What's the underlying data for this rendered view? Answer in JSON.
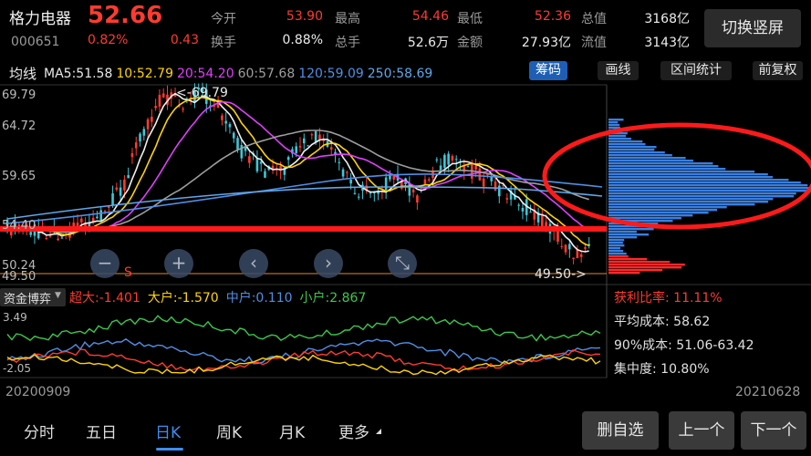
{
  "header": {
    "stock_name": "格力电器",
    "stock_code": "000651",
    "price": "52.66",
    "change_pct": "0.82%",
    "change_amt": "0.43",
    "stats": [
      {
        "label": "今开",
        "value": "53.90",
        "color": "#ff3b30"
      },
      {
        "label": "最高",
        "value": "54.46",
        "color": "#ff3b30"
      },
      {
        "label": "最低",
        "value": "52.36",
        "color": "#ff3b30"
      },
      {
        "label": "总值",
        "value": "3168亿",
        "color": "#ececec"
      },
      {
        "label": "换手",
        "value": "0.88%",
        "color": "#ececec"
      },
      {
        "label": "总手",
        "value": "52.6万",
        "color": "#ececec"
      },
      {
        "label": "金额",
        "value": "27.93亿",
        "color": "#ececec"
      },
      {
        "label": "流值",
        "value": "3143亿",
        "color": "#ececec"
      }
    ],
    "switch_button": "切换竖屏"
  },
  "ma_bar": {
    "label": "均线",
    "items": [
      {
        "text": "MA5:51.58",
        "color": "#e8e8e8"
      },
      {
        "text": "10:52.79",
        "color": "#ffd400"
      },
      {
        "text": "20:54.20",
        "color": "#e040fb"
      },
      {
        "text": "60:57.68",
        "color": "#9e9e9e"
      },
      {
        "text": "120:59.09",
        "color": "#4f8fe6"
      },
      {
        "text": "250:58.69",
        "color": "#5fa7e8"
      }
    ],
    "buttons": [
      {
        "label": "筹码",
        "active": true
      },
      {
        "label": "画线",
        "active": false
      },
      {
        "label": "区间统计",
        "active": false
      },
      {
        "label": "前复权",
        "active": false
      }
    ]
  },
  "price_axis": [
    "69.79",
    "64.72",
    "59.65",
    "54.40",
    "50.24",
    "49.50"
  ],
  "annotations": {
    "high_label": "<-69.79",
    "low_label": "49.50->",
    "s_marker": "S"
  },
  "controls": [
    {
      "name": "zoom-out",
      "glyph": "−"
    },
    {
      "name": "zoom-in",
      "glyph": "+"
    },
    {
      "name": "pan-left",
      "glyph": "‹"
    },
    {
      "name": "pan-right",
      "glyph": "›"
    },
    {
      "name": "collapse",
      "glyph": "⤡"
    }
  ],
  "indicator": {
    "selector": "资金博弈",
    "items": [
      {
        "text": "超大:-1.401",
        "color": "#ff3b30"
      },
      {
        "text": "大户:-1.570",
        "color": "#ffd400"
      },
      {
        "text": "中户:0.110",
        "color": "#4f8fe6"
      },
      {
        "text": "小户:2.867",
        "color": "#3cc84a"
      }
    ],
    "axis_top": "3.49",
    "axis_bottom": "-2.05"
  },
  "dates": {
    "start": "20200909",
    "end": "20210628"
  },
  "chips": {
    "profit_ratio": "获利比率: 11.11%",
    "avg_cost": "平均成本: 58.62",
    "cost90": "90%成本: 51.06-63.42",
    "concentration": "集中度: 10.80%"
  },
  "tabs": [
    {
      "label": "分时",
      "active": false
    },
    {
      "label": "五日",
      "active": false
    },
    {
      "label": "日K",
      "active": true
    },
    {
      "label": "周K",
      "active": false
    },
    {
      "label": "月K",
      "active": false
    },
    {
      "label": "更多",
      "active": false
    }
  ],
  "bottom_buttons": [
    "删自选",
    "上一个",
    "下一个"
  ]
}
